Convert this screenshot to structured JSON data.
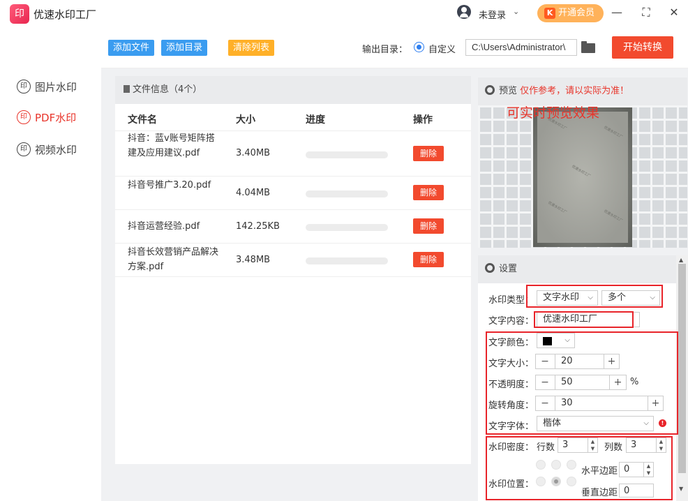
{
  "titlebar": {
    "logo_glyph": "印",
    "app_title": "优速水印工厂",
    "user_label": "未登录",
    "user_chevron": "⌄",
    "vip_label": "开通会员",
    "vip_badge": "K",
    "minimize": "—",
    "maximize": "⛶",
    "close": "✕"
  },
  "sidebar": {
    "items": [
      {
        "icon": "印",
        "label": "图片水印",
        "active": false
      },
      {
        "icon": "印",
        "label": "PDF水印",
        "active": true
      },
      {
        "icon": "印",
        "label": "视频水印",
        "active": false
      }
    ]
  },
  "toolbar": {
    "add_file": "添加文件",
    "add_dir": "添加目录",
    "clear_list": "清除列表",
    "output_label": "输出目录：",
    "radio_label": "自定义",
    "output_path": "C:\\Users\\Administrator\\",
    "start_label": "开始转换"
  },
  "file_panel": {
    "header": "文件信息（4个）",
    "columns": {
      "name": "文件名",
      "size": "大小",
      "progress": "进度",
      "action": "操作"
    },
    "rows": [
      {
        "name": "抖音：蓝v账号矩阵搭建及应用建议.pdf",
        "size": "3.40MB",
        "progress": 0,
        "action": "删除"
      },
      {
        "name": "抖音号推广3.20.pdf",
        "size": "4.04MB",
        "progress": 0,
        "action": "删除"
      },
      {
        "name": "抖音运营经验.pdf",
        "size": "142.25KB",
        "progress": 0,
        "action": "删除"
      },
      {
        "name": "抖音长效营销产品解决方案.pdf",
        "size": "3.48MB",
        "progress": 0,
        "action": "删除"
      }
    ]
  },
  "preview": {
    "title": "预览",
    "note": "仅作参考，请以实际为准！",
    "live_label": "可实时预览效果",
    "watermark_text": "优速水印工厂"
  },
  "settings": {
    "title": "设置",
    "wm_type_label": "水印类型：",
    "wm_type_value": "文字水印",
    "wm_count_value": "多个",
    "text_content_label": "文字内容：",
    "text_content_value": "优速水印工厂",
    "color_label": "文字颜色：",
    "color_value": "#000000",
    "size_label": "文字大小：",
    "size_value": "20",
    "opacity_label": "不透明度：",
    "opacity_value": "50",
    "opacity_unit": "%",
    "rotate_label": "旋转角度：",
    "rotate_value": "30",
    "font_label": "文字字体：",
    "font_value": "楷体",
    "density_label": "水印密度：",
    "rows_label": "行数",
    "rows_value": "3",
    "cols_label": "列数",
    "cols_value": "3",
    "position_label": "水印位置：",
    "h_margin_label": "水平边距",
    "h_margin_value": "0",
    "v_margin_label": "垂直边距",
    "v_margin_value": "0",
    "minus": "−",
    "plus": "+",
    "chevron": "⌵",
    "spin_up": "▲",
    "spin_down": "▼"
  },
  "colors": {
    "accent_red": "#e8342a",
    "blue": "#3a9cf0",
    "orange": "#ffb028",
    "start_button": "#f24a2e"
  }
}
